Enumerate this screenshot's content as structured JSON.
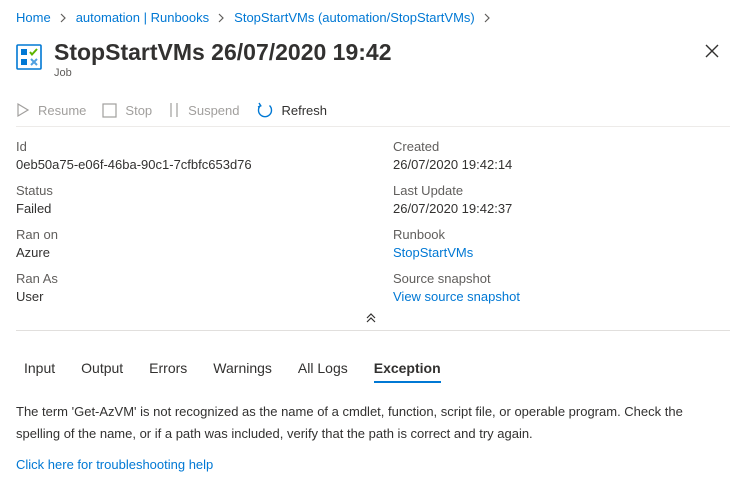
{
  "breadcrumb": {
    "items": [
      "Home",
      "automation | Runbooks",
      "StopStartVMs (automation/StopStartVMs)"
    ]
  },
  "header": {
    "title": "StopStartVMs 26/07/2020 19:42",
    "subtitle": "Job",
    "icon": "runbook-job-icon"
  },
  "toolbar": {
    "resume_label": "Resume",
    "stop_label": "Stop",
    "suspend_label": "Suspend",
    "refresh_label": "Refresh"
  },
  "details": {
    "left": [
      {
        "label": "Id",
        "value": "0eb50a75-e06f-46ba-90c1-7cfbfc653d76"
      },
      {
        "label": "Status",
        "value": "Failed"
      },
      {
        "label": "Ran on",
        "value": "Azure"
      },
      {
        "label": "Ran As",
        "value": "User"
      }
    ],
    "right": [
      {
        "label": "Created",
        "value": "26/07/2020 19:42:14"
      },
      {
        "label": "Last Update",
        "value": "26/07/2020 19:42:37"
      },
      {
        "label": "Runbook",
        "value": "StopStartVMs"
      },
      {
        "label": "Source snapshot",
        "value": "View source snapshot"
      }
    ]
  },
  "tabs": [
    "Input",
    "Output",
    "Errors",
    "Warnings",
    "All Logs",
    "Exception"
  ],
  "active_tab": "Exception",
  "exception": {
    "message": "The term 'Get-AzVM' is not recognized as the name of a cmdlet, function, script file, or operable program. Check the spelling of the name, or if a path was included, verify that the path is correct and try again.",
    "help_link": "Click here for troubleshooting help"
  },
  "colors": {
    "accent": "#0078d4",
    "text": "#323130",
    "muted": "#605e5c",
    "disabled": "#a19f9d"
  }
}
